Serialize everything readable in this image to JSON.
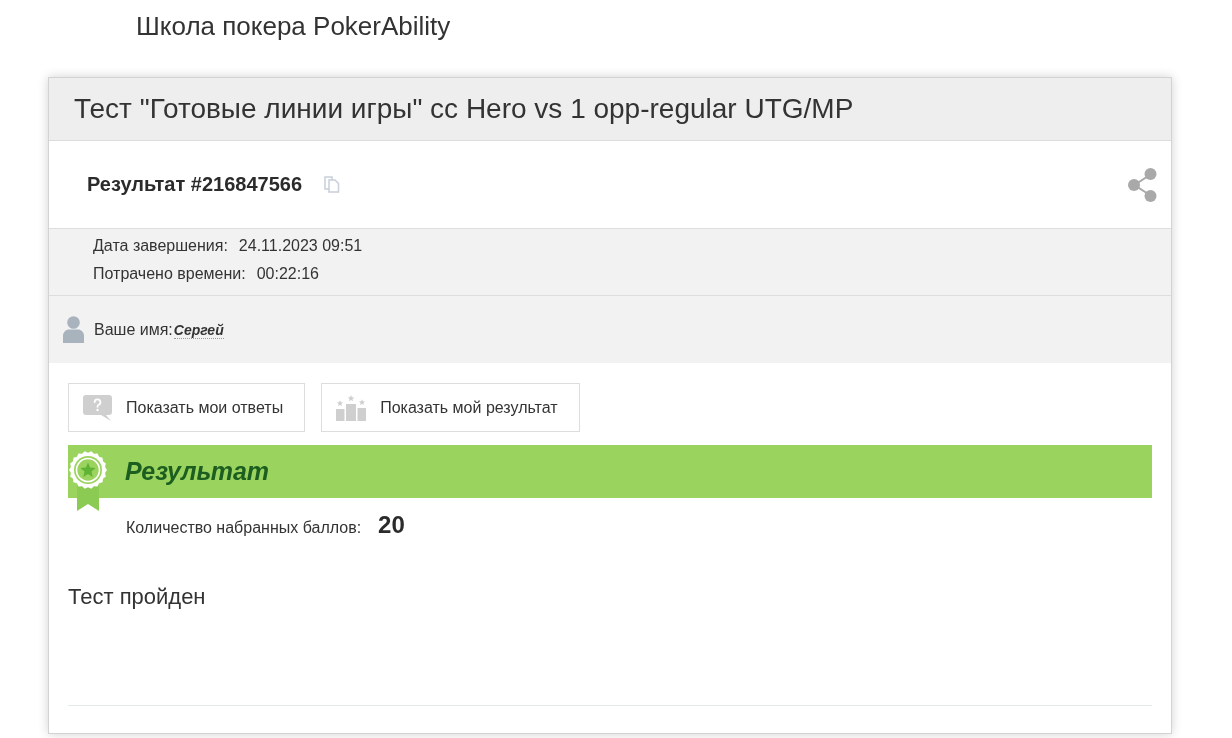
{
  "site_title": "Школа покера PokerAbility",
  "test": {
    "title": "Тест \"Готовые линии игры\" cc Hero vs 1 opp-regular UTG/MP"
  },
  "result": {
    "heading": "Результат #216847566"
  },
  "details": [
    {
      "label": "Дата завершения:",
      "value": "24.11.2023 09:51"
    },
    {
      "label": "Потрачено времени:",
      "value": "00:22:16"
    }
  ],
  "user": {
    "label": "Ваше имя:",
    "name": "Сергей"
  },
  "buttons": [
    {
      "kind": "answers",
      "label": "Показать мои ответы"
    },
    {
      "kind": "result",
      "label": "Показать мой результат"
    }
  ],
  "result_panel": {
    "title": "Результат",
    "score_label": "Количество набранных баллов:",
    "score": "20"
  },
  "verdict": "Тест пройден"
}
